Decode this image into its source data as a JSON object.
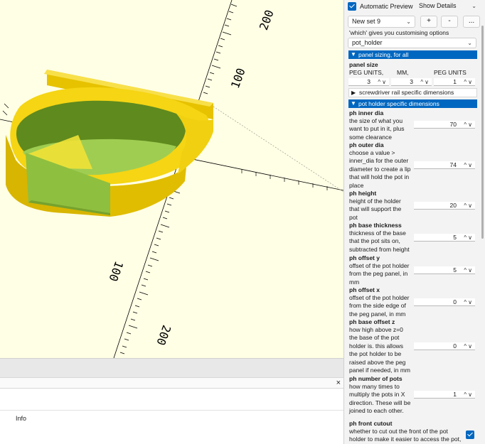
{
  "colors": {
    "accent": "#0067c0",
    "viewport_bg": "#ffffe5",
    "part_yellow": "#f5d514",
    "part_green": "#9fcd52"
  },
  "viewport": {
    "axis_labels": [
      "200",
      "100",
      "100",
      "200"
    ]
  },
  "console": {
    "close_icon": "×",
    "info_label": "Info"
  },
  "header": {
    "automatic_preview_label": "Automatic Preview",
    "automatic_preview_checked": true,
    "details_combo": "Show Details",
    "preset_combo": "New set 9",
    "add_button": "+",
    "remove_button": "-",
    "more_button": "..."
  },
  "params": {
    "which_desc": "'which' gives you customising options",
    "which_value": "pot_holder",
    "section_panel": "panel sizing, for all",
    "panel_size_label": "panel size",
    "col_peg_units": "PEG UNITS,",
    "col_mm": "MM,",
    "col_peg_units2": "PEG UNITS",
    "panel_size_values": [
      "3",
      "3",
      "1"
    ],
    "screwdriver_section": "screwdriver rail specific dimensions",
    "section_pot": "pot holder specific dimensions",
    "ph_inner_dia": {
      "label": "ph inner dia",
      "desc": [
        "the size of what you",
        "want to put in it, plus",
        "some clearance"
      ],
      "value": "70"
    },
    "ph_outer_dia": {
      "label": "ph outer dia",
      "desc": [
        "choose a value >",
        "inner_dia for the outer",
        "diameter to create a lip",
        "that will hold the pot in",
        "place"
      ],
      "value": "74"
    },
    "ph_height": {
      "label": "ph height",
      "desc": [
        "height of the holder",
        "that will support the",
        "pot"
      ],
      "value": "20"
    },
    "ph_base_thickness": {
      "label": "ph base thickness",
      "desc": [
        "thickness of the base",
        "that the pot sits on,",
        "subtracted from height"
      ],
      "value": "5"
    },
    "ph_offset_y": {
      "label": "ph offset y",
      "desc": [
        "offset of the pot holder",
        "from the peg panel, in",
        "mm"
      ],
      "value": "5"
    },
    "ph_offset_x": {
      "label": "ph offset x",
      "desc": [
        "offset of the pot holder",
        "from the side edge of",
        "the peg panel, in mm"
      ],
      "value": "0"
    },
    "ph_base_offset_z": {
      "label": "ph base offset z",
      "desc": [
        "how high above z=0",
        "the base of the pot",
        "holder is. this allows",
        "the pot holder to be",
        "raised above the peg",
        "panel if needed, in mm"
      ],
      "value": "0"
    },
    "ph_number_of_pots": {
      "label": "ph number of pots",
      "desc": [
        "how many times to",
        "multiply the pots in X",
        "direction. These will be",
        "joined to each other."
      ],
      "value": "1"
    },
    "ph_front_cutout": {
      "label": "ph front cutout",
      "desc": [
        "whether to cut out the front of the pot",
        "holder to make it easier to access the pot,"
      ],
      "checked": true
    }
  }
}
